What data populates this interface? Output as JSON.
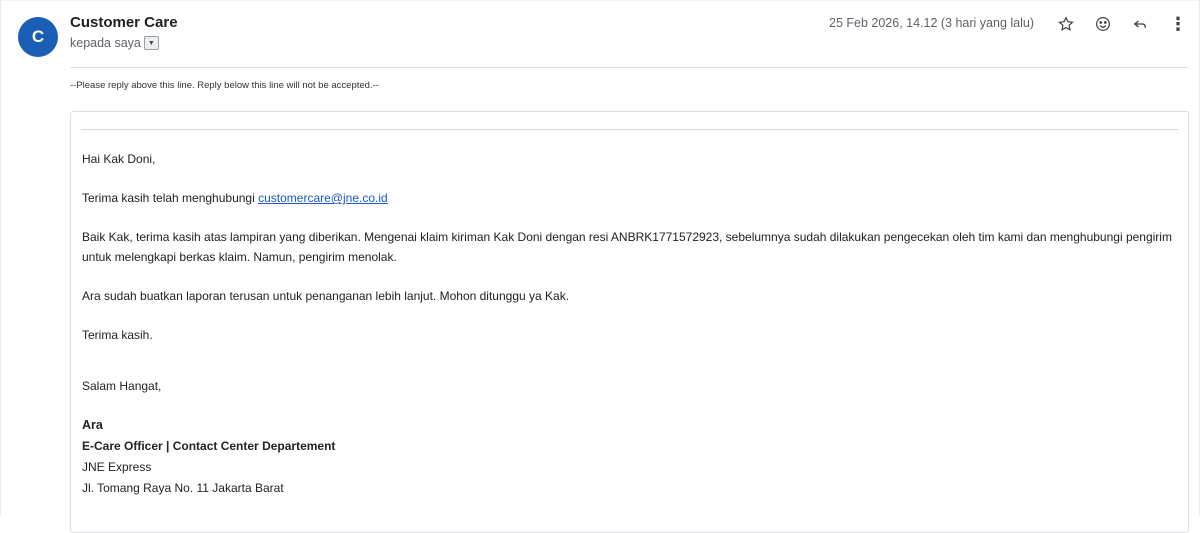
{
  "header": {
    "avatar_letter": "C",
    "sender_name": "Customer Care",
    "recipient_text": "kepada saya",
    "date": "25 Feb 2026, 14.12 (3 hari yang lalu)"
  },
  "icons": {
    "star": "star-icon",
    "emoji": "emoji-icon",
    "reply": "reply-icon",
    "more": "more-vert-icon",
    "dropdown": "dropdown-icon"
  },
  "message": {
    "reply_notice": "--Please reply above this line. Reply below this line will not be accepted.--",
    "greeting": "Hai Kak Doni,",
    "thanks_prefix": "Terima kasih telah menghubungi ",
    "thanks_email": "customercare@jne.co.id",
    "body_paragraph": "Baik Kak, terima kasih atas lampiran yang diberikan. Mengenai klaim kiriman Kak Doni dengan resi ANBRK1771572923, sebelumnya sudah dilakukan pengecekan oleh tim kami dan menghubungi pengirim untuk melengkapi berkas klaim. Namun, pengirim menolak.",
    "followup_paragraph": "Ara sudah buatkan laporan terusan untuk penanganan lebih lanjut. Mohon ditunggu ya Kak.",
    "closing_thanks": "Terima kasih.",
    "signoff": "Salam Hangat,"
  },
  "signature": {
    "name": "Ara",
    "title": "E-Care Officer | Contact Center Departement",
    "company": "JNE Express",
    "address": "Jl. Tomang Raya No. 11 Jakarta Barat"
  },
  "colors": {
    "avatar": "#1a5fb4",
    "link": "#1a57c9"
  }
}
